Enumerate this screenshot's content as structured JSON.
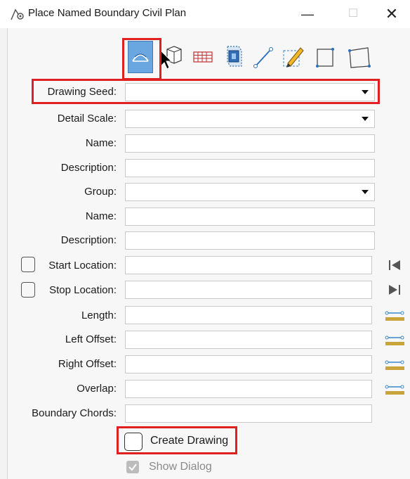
{
  "window": {
    "title": "Place Named Boundary Civil Plan",
    "icons": {
      "app": "named-boundary-app-icon",
      "minimize": "minimize-icon",
      "maximize": "maximize-icon",
      "close": "close-icon"
    }
  },
  "toolbar": {
    "tools": [
      {
        "name": "civil-plan-tool",
        "active": true
      },
      {
        "name": "pointer-tool",
        "active": false
      },
      {
        "name": "grid-tool",
        "active": false
      },
      {
        "name": "volume-tool",
        "active": false
      },
      {
        "name": "line-tool",
        "active": false
      },
      {
        "name": "pencil-tool",
        "active": false
      },
      {
        "name": "square-tool",
        "active": false
      },
      {
        "name": "skew-square-tool",
        "active": false
      }
    ]
  },
  "form": {
    "drawing_seed_label": "Drawing Seed:",
    "detail_scale_label": "Detail Scale:",
    "name_label": "Name:",
    "description_label": "Description:",
    "group_label": "Group:",
    "group_name_label": "Name:",
    "group_description_label": "Description:",
    "start_location_label": "Start Location:",
    "stop_location_label": "Stop Location:",
    "length_label": "Length:",
    "left_offset_label": "Left Offset:",
    "right_offset_label": "Right Offset:",
    "overlap_label": "Overlap:",
    "boundary_chords_label": "Boundary Chords:"
  },
  "options": {
    "create_drawing_label": "Create Drawing",
    "create_drawing_checked": false,
    "show_dialog_label": "Show Dialog",
    "show_dialog_checked": true,
    "show_dialog_enabled": false
  },
  "colors": {
    "highlight": "#e02020",
    "active_tool": "#6aa6e0",
    "measure_icon": "#3a86c8",
    "measure_ruler": "#c8a43a"
  }
}
